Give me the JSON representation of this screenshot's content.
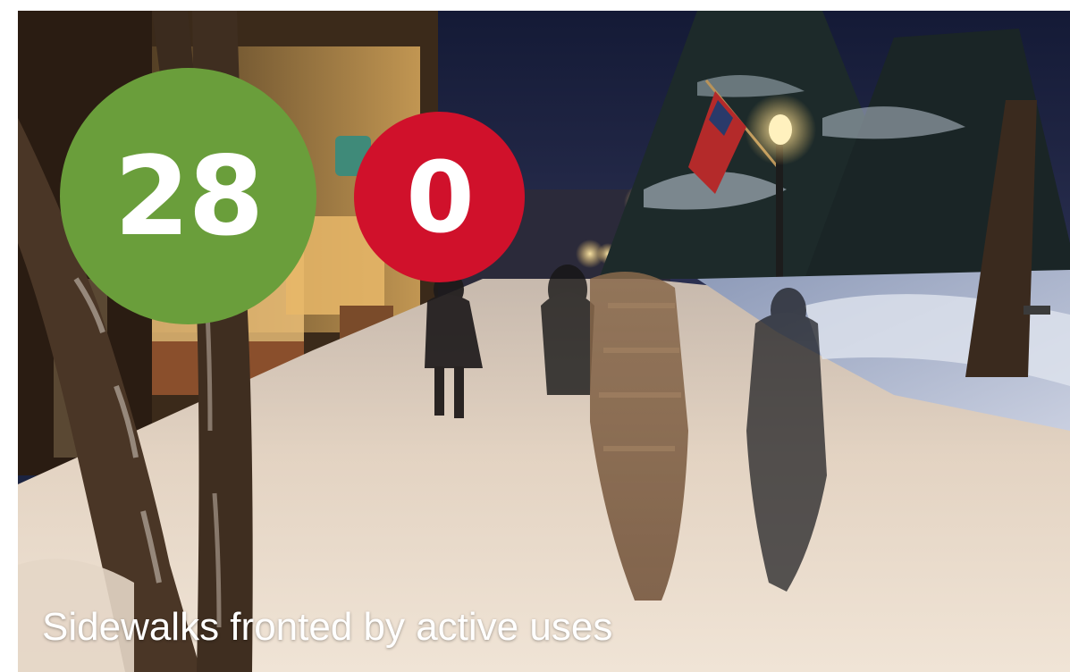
{
  "photo": {
    "subject": "snowy-evening-sidewalk-with-pedestrians"
  },
  "badges": {
    "green_count": "28",
    "red_count": "0"
  },
  "caption": "Sidewalks fronted by active uses",
  "colors": {
    "green": "#6a9e3b",
    "red": "#d0112b",
    "caption_text": "#ffffff",
    "night_sky": "#1b2340",
    "snow": "#e8dccd"
  }
}
